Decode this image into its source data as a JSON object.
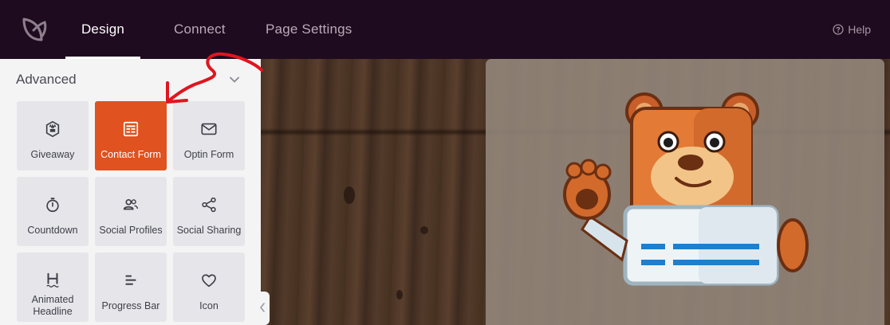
{
  "nav": {
    "tabs": [
      {
        "label": "Design",
        "active": true
      },
      {
        "label": "Connect",
        "active": false
      },
      {
        "label": "Page Settings",
        "active": false
      }
    ],
    "help_label": "Help"
  },
  "sidebar": {
    "section_title": "Advanced",
    "blocks": [
      {
        "label": "Giveaway",
        "icon": "giveaway-icon"
      },
      {
        "label": "Contact Form",
        "icon": "contact-form-icon",
        "selected": true
      },
      {
        "label": "Optin Form",
        "icon": "envelope-icon"
      },
      {
        "label": "Countdown",
        "icon": "stopwatch-icon"
      },
      {
        "label": "Social Profiles",
        "icon": "people-icon"
      },
      {
        "label": "Social Sharing",
        "icon": "share-icon"
      },
      {
        "label": "Animated Headline",
        "icon": "headline-icon"
      },
      {
        "label": "Progress Bar",
        "icon": "progress-bar-icon"
      },
      {
        "label": "Icon",
        "icon": "heart-icon"
      }
    ]
  },
  "colors": {
    "topbar": "#1f0b1f",
    "accent": "#e0521f",
    "sidebar_bg": "#f4f4f5",
    "tile_bg": "#e6e6ea",
    "annotation_arrow": "#e0151f"
  }
}
